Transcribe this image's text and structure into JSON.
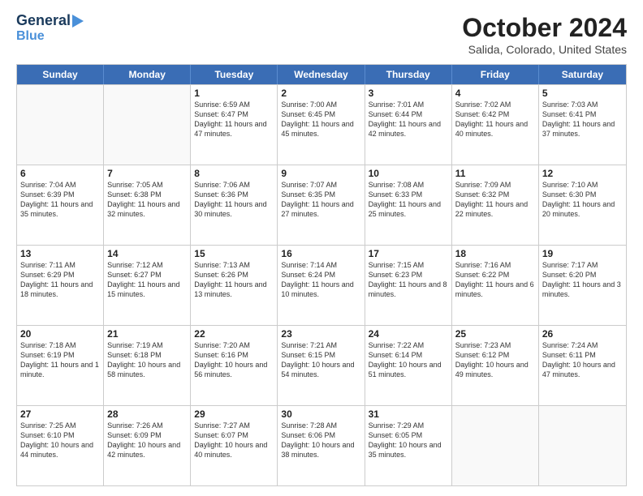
{
  "logo": {
    "line1": "General",
    "line2": "Blue"
  },
  "title": "October 2024",
  "subtitle": "Salida, Colorado, United States",
  "headers": [
    "Sunday",
    "Monday",
    "Tuesday",
    "Wednesday",
    "Thursday",
    "Friday",
    "Saturday"
  ],
  "rows": [
    [
      {
        "date": "",
        "text": ""
      },
      {
        "date": "",
        "text": ""
      },
      {
        "date": "1",
        "text": "Sunrise: 6:59 AM\nSunset: 6:47 PM\nDaylight: 11 hours and 47 minutes."
      },
      {
        "date": "2",
        "text": "Sunrise: 7:00 AM\nSunset: 6:45 PM\nDaylight: 11 hours and 45 minutes."
      },
      {
        "date": "3",
        "text": "Sunrise: 7:01 AM\nSunset: 6:44 PM\nDaylight: 11 hours and 42 minutes."
      },
      {
        "date": "4",
        "text": "Sunrise: 7:02 AM\nSunset: 6:42 PM\nDaylight: 11 hours and 40 minutes."
      },
      {
        "date": "5",
        "text": "Sunrise: 7:03 AM\nSunset: 6:41 PM\nDaylight: 11 hours and 37 minutes."
      }
    ],
    [
      {
        "date": "6",
        "text": "Sunrise: 7:04 AM\nSunset: 6:39 PM\nDaylight: 11 hours and 35 minutes."
      },
      {
        "date": "7",
        "text": "Sunrise: 7:05 AM\nSunset: 6:38 PM\nDaylight: 11 hours and 32 minutes."
      },
      {
        "date": "8",
        "text": "Sunrise: 7:06 AM\nSunset: 6:36 PM\nDaylight: 11 hours and 30 minutes."
      },
      {
        "date": "9",
        "text": "Sunrise: 7:07 AM\nSunset: 6:35 PM\nDaylight: 11 hours and 27 minutes."
      },
      {
        "date": "10",
        "text": "Sunrise: 7:08 AM\nSunset: 6:33 PM\nDaylight: 11 hours and 25 minutes."
      },
      {
        "date": "11",
        "text": "Sunrise: 7:09 AM\nSunset: 6:32 PM\nDaylight: 11 hours and 22 minutes."
      },
      {
        "date": "12",
        "text": "Sunrise: 7:10 AM\nSunset: 6:30 PM\nDaylight: 11 hours and 20 minutes."
      }
    ],
    [
      {
        "date": "13",
        "text": "Sunrise: 7:11 AM\nSunset: 6:29 PM\nDaylight: 11 hours and 18 minutes."
      },
      {
        "date": "14",
        "text": "Sunrise: 7:12 AM\nSunset: 6:27 PM\nDaylight: 11 hours and 15 minutes."
      },
      {
        "date": "15",
        "text": "Sunrise: 7:13 AM\nSunset: 6:26 PM\nDaylight: 11 hours and 13 minutes."
      },
      {
        "date": "16",
        "text": "Sunrise: 7:14 AM\nSunset: 6:24 PM\nDaylight: 11 hours and 10 minutes."
      },
      {
        "date": "17",
        "text": "Sunrise: 7:15 AM\nSunset: 6:23 PM\nDaylight: 11 hours and 8 minutes."
      },
      {
        "date": "18",
        "text": "Sunrise: 7:16 AM\nSunset: 6:22 PM\nDaylight: 11 hours and 6 minutes."
      },
      {
        "date": "19",
        "text": "Sunrise: 7:17 AM\nSunset: 6:20 PM\nDaylight: 11 hours and 3 minutes."
      }
    ],
    [
      {
        "date": "20",
        "text": "Sunrise: 7:18 AM\nSunset: 6:19 PM\nDaylight: 11 hours and 1 minute."
      },
      {
        "date": "21",
        "text": "Sunrise: 7:19 AM\nSunset: 6:18 PM\nDaylight: 10 hours and 58 minutes."
      },
      {
        "date": "22",
        "text": "Sunrise: 7:20 AM\nSunset: 6:16 PM\nDaylight: 10 hours and 56 minutes."
      },
      {
        "date": "23",
        "text": "Sunrise: 7:21 AM\nSunset: 6:15 PM\nDaylight: 10 hours and 54 minutes."
      },
      {
        "date": "24",
        "text": "Sunrise: 7:22 AM\nSunset: 6:14 PM\nDaylight: 10 hours and 51 minutes."
      },
      {
        "date": "25",
        "text": "Sunrise: 7:23 AM\nSunset: 6:12 PM\nDaylight: 10 hours and 49 minutes."
      },
      {
        "date": "26",
        "text": "Sunrise: 7:24 AM\nSunset: 6:11 PM\nDaylight: 10 hours and 47 minutes."
      }
    ],
    [
      {
        "date": "27",
        "text": "Sunrise: 7:25 AM\nSunset: 6:10 PM\nDaylight: 10 hours and 44 minutes."
      },
      {
        "date": "28",
        "text": "Sunrise: 7:26 AM\nSunset: 6:09 PM\nDaylight: 10 hours and 42 minutes."
      },
      {
        "date": "29",
        "text": "Sunrise: 7:27 AM\nSunset: 6:07 PM\nDaylight: 10 hours and 40 minutes."
      },
      {
        "date": "30",
        "text": "Sunrise: 7:28 AM\nSunset: 6:06 PM\nDaylight: 10 hours and 38 minutes."
      },
      {
        "date": "31",
        "text": "Sunrise: 7:29 AM\nSunset: 6:05 PM\nDaylight: 10 hours and 35 minutes."
      },
      {
        "date": "",
        "text": ""
      },
      {
        "date": "",
        "text": ""
      }
    ]
  ]
}
